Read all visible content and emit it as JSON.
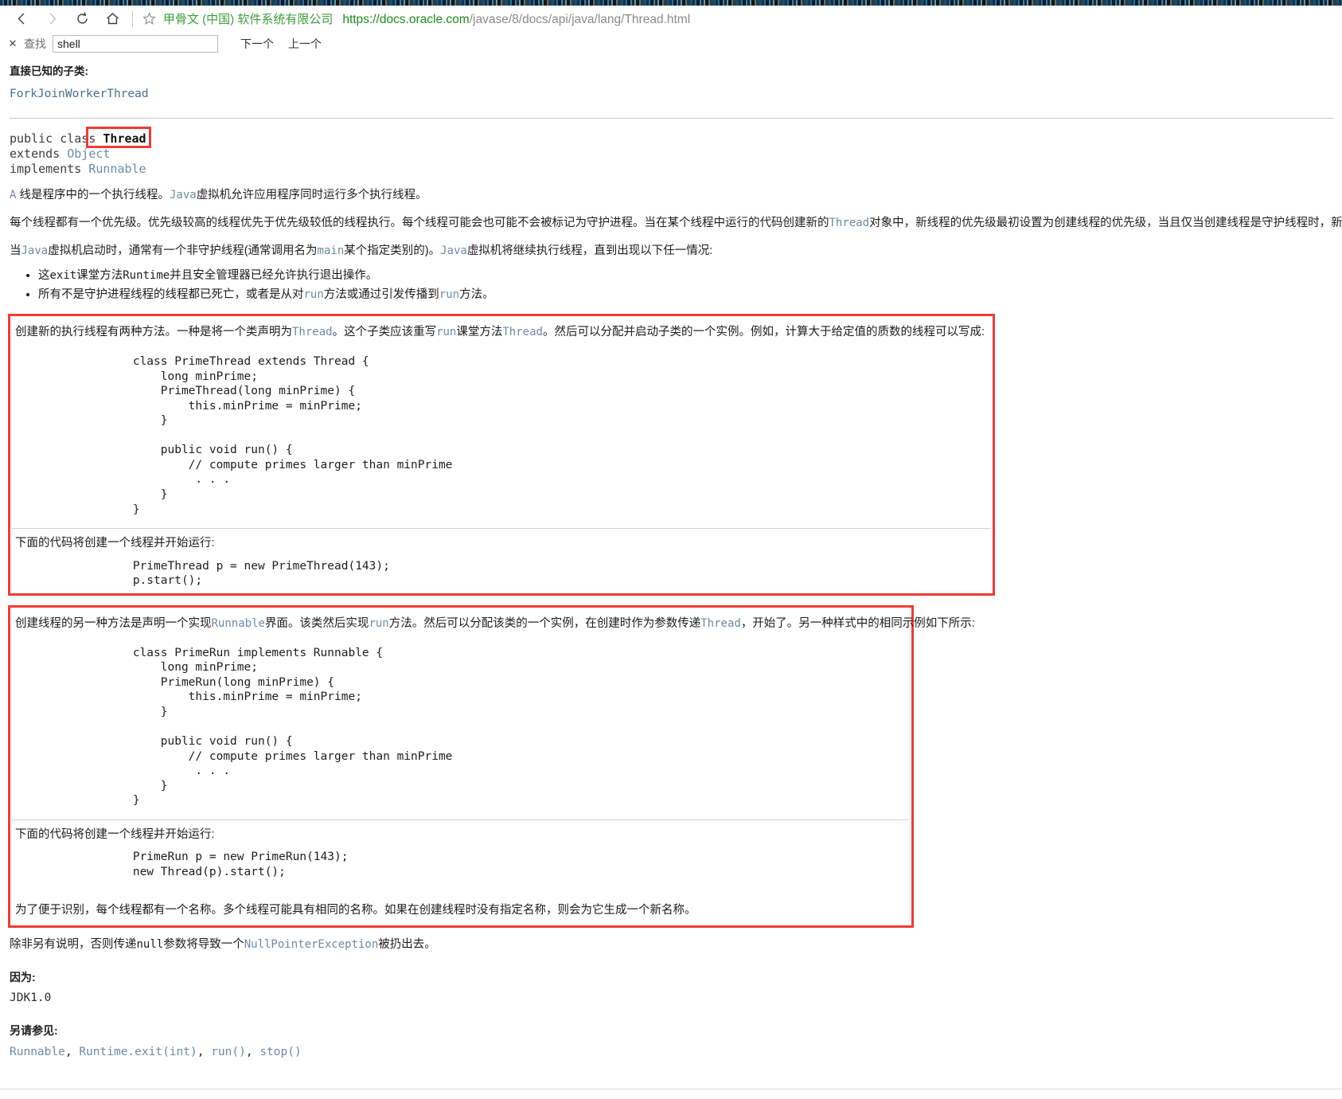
{
  "browser": {
    "back_icon": "back-chevron-icon",
    "forward_icon": "forward-chevron-icon",
    "reload_icon": "reload-icon",
    "home_icon": "home-icon",
    "favorite_icon": "star-icon",
    "site_org": "甲骨文 (中国) 软件系统有限公司",
    "url_scheme": "https://",
    "url_host": "docs.oracle.com",
    "url_path": "/javase/8/docs/api/java/lang/Thread.html"
  },
  "findbar": {
    "close_icon": "close-icon",
    "label": "查找",
    "value": "shell",
    "placeholder": "",
    "next_label": "下一个",
    "prev_label": "上一个"
  },
  "doc": {
    "subclasses_heading": "直接已知的子类:",
    "subclasses_link": "ForkJoinWorkerThread",
    "declaration": {
      "line1_prefix": "public class",
      "class_name": "Thread",
      "line2_kw": "extends",
      "line2_type": "Object",
      "line3_kw": "implements",
      "line3_type": "Runnable"
    },
    "intro_a": "A",
    "intro_text1": "线是程序中的一个执行线程。",
    "intro_java": "Java",
    "intro_text2": "虚拟机允许应用程序同时运行多个执行线程。",
    "para2": "每个线程都有一个优先级。优先级较高的线程优先于优先级较低的线程执行。每个线程可能会也可能不会被标记为守护进程。当在某个线程中运行的代码创建新的",
    "para2_thread": "Thread",
    "para2_cont": "对象中，新线程的优先级最初设置为创建线程的优先级，当且仅当创建线程是守护线程时，新线程才是",
    "para3_pre": "当",
    "para3_java": "Java",
    "para3_mid": "虚拟机启动时，通常有一个非守护线程(通常调用名为",
    "para3_main": "main",
    "para3_mid2": "某个指定类别的)。",
    "para3_java2": "Java",
    "para3_end": "虚拟机将继续执行线程，直到出现以下任一情况:",
    "bullets": [
      {
        "pre": "这",
        "code1": "exit",
        "mid": "课堂方法",
        "code2": "Runtime",
        "post": "并且安全管理器已经允许执行退出操作。"
      },
      {
        "pre": "所有不是守护进程线程的线程都已死亡，或者是从对",
        "code1": "run",
        "mid": "方法或通过引发传播到",
        "code2": "run",
        "post": "方法。"
      }
    ],
    "box1": {
      "intro_pre": "创建新的执行线程有两种方法。一种是将一个类声明为",
      "intro_code1": "Thread",
      "intro_mid": "。这个子类应该重写",
      "intro_code2": "run",
      "intro_mid2": "课堂方法",
      "intro_code3": "Thread",
      "intro_post": "。然后可以分配并启动子类的一个实例。例如，计算大于给定值的质数的线程可以写成:",
      "code": "        class PrimeThread extends Thread {\n            long minPrime;\n            PrimeThread(long minPrime) {\n                this.minPrime = minPrime;\n            }\n\n            public void run() {\n                // compute primes larger than minPrime\n                 . . .\n            }\n        }",
      "run_caption": "下面的代码将创建一个线程并开始运行:",
      "run_code": "        PrimeThread p = new PrimeThread(143);\n        p.start();"
    },
    "box2": {
      "intro_pre": "创建线程的另一种方法是声明一个实现",
      "intro_code1": "Runnable",
      "intro_mid": "界面。该类然后实现",
      "intro_code2": "run",
      "intro_mid2": "方法。然后可以分配该类的一个实例，在创建时作为参数传递",
      "intro_code3": "Thread",
      "intro_post": "，开始了。另一种样式中的相同示例如下所示:",
      "code": "        class PrimeRun implements Runnable {\n            long minPrime;\n            PrimeRun(long minPrime) {\n                this.minPrime = minPrime;\n            }\n\n            public void run() {\n                // compute primes larger than minPrime\n                 . . .\n            }\n        }",
      "run_caption": "下面的代码将创建一个线程并开始运行:",
      "run_code": "        PrimeRun p = new PrimeRun(143);\n        new Thread(p).start();",
      "name_para": "为了便于识别，每个线程都有一个名称。多个线程可能具有相同的名称。如果在创建线程时没有指定名称，则会为它生成一个新名称。"
    },
    "npe_pre": "除非另有说明，否则传递",
    "npe_code1": "null",
    "npe_mid": "参数将导致一个",
    "npe_code2": "NullPointerException",
    "npe_post": "被扔出去。",
    "since_heading": "因为:",
    "since_value": "JDK1.0",
    "seealso_heading": "另请参见:",
    "seealso_links": [
      "Runnable",
      "Runtime.exit(int)",
      "run()",
      "stop()"
    ]
  },
  "colors": {
    "annotation_red": "#ef3b36",
    "link_blue": "#6b8aa5",
    "url_green": "#3a9e3a"
  }
}
